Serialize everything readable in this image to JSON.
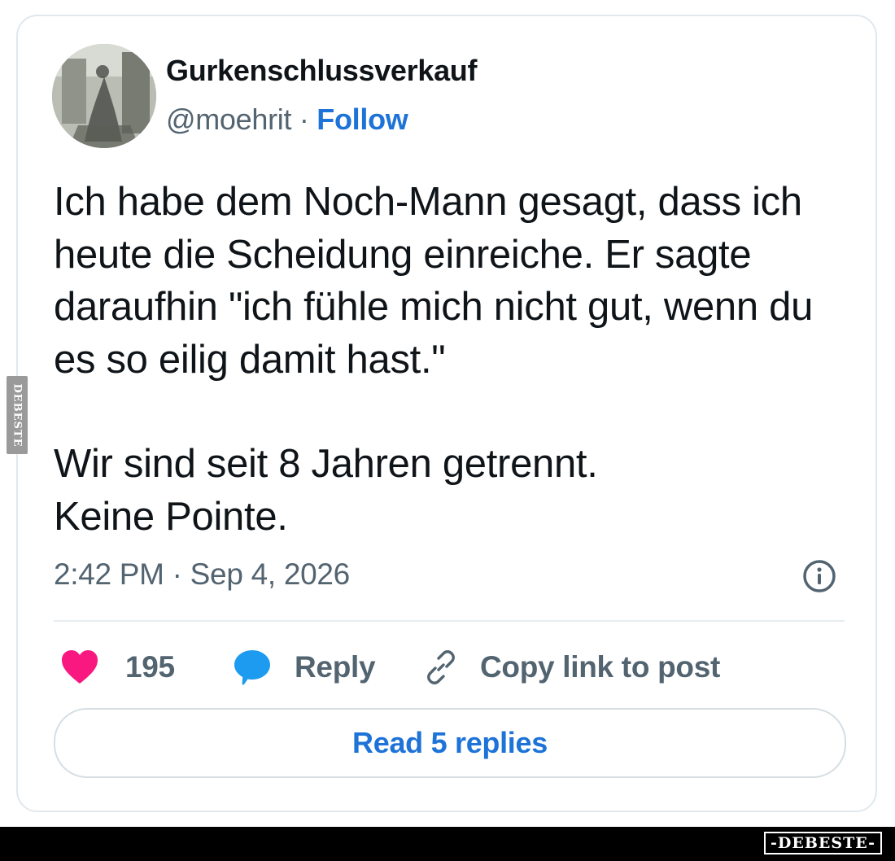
{
  "author": {
    "name": "Gurkenschlussverkauf",
    "handle": "@moehrit",
    "separator": " · ",
    "follow_label": "Follow"
  },
  "tweet": {
    "paragraphs": [
      "Ich habe dem Noch-Mann gesagt, dass ich heute die Scheidung einreiche. Er sagte daraufhin \"ich fühle mich nicht gut, wenn du es so eilig damit hast.\"",
      "Wir sind seit 8 Jahren getrennt.",
      "Keine Pointe."
    ],
    "timestamp": "2:42 PM · Sep 4, 2026"
  },
  "actions": {
    "like_count": "195",
    "reply_label": "Reply",
    "copy_link_label": "Copy link to post"
  },
  "read_replies_label": "Read 5 replies",
  "watermark": {
    "side_text": "DEBESTE",
    "bottom_text": "-DEBESTE-"
  },
  "icons": {
    "like": "heart-icon",
    "reply": "speech-bubble-icon",
    "copy": "link-icon",
    "info": "info-icon"
  },
  "colors": {
    "link_blue": "#1d73d8",
    "heart_pink": "#f91880",
    "reply_blue": "#1d9bf0",
    "muted_text": "#536471"
  }
}
